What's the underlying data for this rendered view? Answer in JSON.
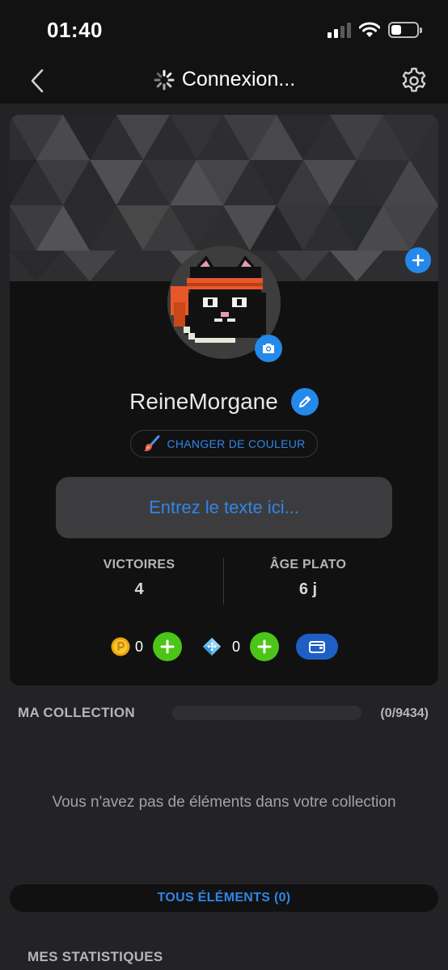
{
  "status_bar": {
    "time": "01:40",
    "signal_icon": "cellular-signal-icon",
    "wifi_icon": "wifi-icon",
    "battery_icon": "battery-icon"
  },
  "nav": {
    "back_icon": "chevron-left-icon",
    "spinner_icon": "loading-spinner-icon",
    "title": "Connexion...",
    "settings_icon": "gear-icon"
  },
  "profile": {
    "banner_add_icon": "plus-icon",
    "camera_icon": "camera-icon",
    "username": "ReineMorgane",
    "edit_icon": "pencil-icon",
    "color_button_icon": "paintbrush-icon",
    "color_button_label": "CHANGER DE COULEUR",
    "bio_placeholder": "Entrez le texte ici...",
    "stats": [
      {
        "label": "VICTOIRES",
        "value": "4"
      },
      {
        "label": "ÂGE PLATO",
        "value": "6 j"
      }
    ],
    "currencies": [
      {
        "icon": "coin-icon",
        "value": "0"
      },
      {
        "icon": "dice-gem-icon",
        "value": "0"
      }
    ],
    "wallet_icon": "wallet-icon"
  },
  "collection": {
    "title": "MA COLLECTION",
    "count": "(0/9434)",
    "progress": 0,
    "empty_text": "Vous n'avez pas de éléments dans votre collection",
    "all_items_label": "TOUS ÉLÉMENTS (0)"
  },
  "stats_section": {
    "title": "MES STATISTIQUES"
  },
  "colors": {
    "accent_blue": "#2489ea",
    "link_blue": "#2f86e6",
    "plus_green": "#4bc518",
    "wallet_blue": "#1f5fc4",
    "background": "#232325",
    "card": "#111112"
  }
}
